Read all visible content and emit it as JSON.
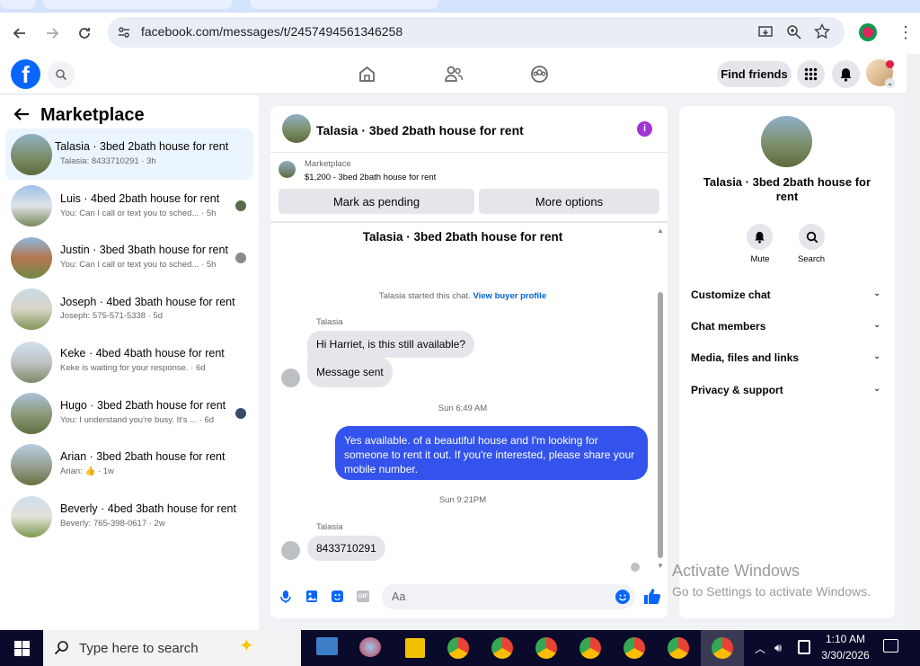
{
  "browser": {
    "url": "facebook.com/messages/t/2457494561346258"
  },
  "topnav": {
    "find_friends": "Find friends"
  },
  "sidebar": {
    "title": "Marketplace",
    "conversations": [
      {
        "name": "Talasia · 3bed 2bath house for rent",
        "preview": "Talasia: 8433710291 · 3h"
      },
      {
        "name": "Luis · 4bed 2bath house for rent",
        "preview": "You: Can I call or text you to sched... · 5h"
      },
      {
        "name": "Justin · 3bed 3bath house for rent",
        "preview": "You: Can I call or text you to sched... · 5h"
      },
      {
        "name": "Joseph · 4bed 3bath house for rent",
        "preview": "Joseph: 575-571-5338 · 5d"
      },
      {
        "name": "Keke · 4bed 4bath house for rent",
        "preview": "Keke is waiting for your response. · 6d"
      },
      {
        "name": "Hugo · 3bed 2bath house for rent",
        "preview": "You: I understand you're busy. It's ... · 6d"
      },
      {
        "name": "Arian · 3bed 2bath house for rent",
        "preview": "Arian: 👍 · 1w"
      },
      {
        "name": "Beverly · 4bed 3bath house for rent",
        "preview": "Beverly: 765-398-0617 · 2w"
      }
    ]
  },
  "chat": {
    "title": "Talasia · 3bed 2bath house for rent",
    "listing_source": "Marketplace",
    "listing_info": "$1,200 - 3bed 2bath house for rent",
    "mark_pending": "Mark as pending",
    "more_options": "More options",
    "header_title": "Talasia · 3bed 2bath house for rent",
    "started_text": "Talasia started this chat.",
    "view_profile": "View buyer profile",
    "sender1": "Talasia",
    "msg1": "Hi Harriet, is this still available?",
    "msg2": "Message sent",
    "ts1": "Sun 6:49 AM",
    "msg3": "Yes available. of a beautiful house and I'm looking for someone to rent it out. If you're interested, please share your mobile number.",
    "ts2": "Sun 9:21PM",
    "sender2": "Talasia",
    "msg4": "8433710291",
    "input_placeholder": "Aa"
  },
  "details": {
    "title": "Talasia · 3bed 2bath house for rent",
    "mute": "Mute",
    "search": "Search",
    "menu": [
      "Customize chat",
      "Chat members",
      "Media, files and links",
      "Privacy & support"
    ]
  },
  "watermark": {
    "line1": "Activate Windows",
    "line2": "Go to Settings to activate Windows."
  },
  "taskbar": {
    "search_placeholder": "Type here to search",
    "time": "1:10 AM",
    "date": "3/30/2026"
  },
  "colors": {
    "fb_blue": "#0866ff",
    "bubble_blue": "#3353ec",
    "link": "#0064d1"
  }
}
